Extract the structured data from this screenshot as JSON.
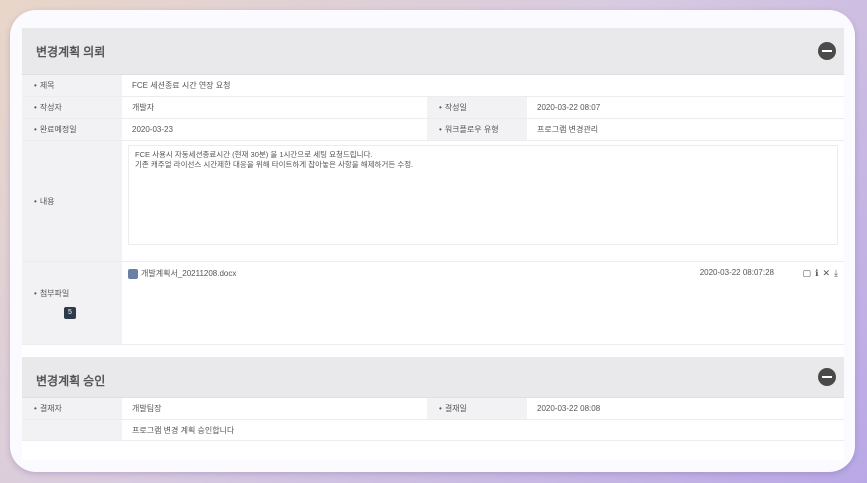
{
  "section1": {
    "title": "변경계획 의뢰",
    "rows": {
      "subject_label": "제목",
      "subject_value": "FCE 세션종료 시간 연장 요청",
      "author_label": "작성자",
      "author_value": "개발자",
      "written_label": "작성일",
      "written_value": "2020-03-22 08:07",
      "due_label": "완료예정일",
      "due_value": "2020-03-23",
      "workflow_label": "워크플로우 유형",
      "workflow_value": "프로그램 변경관리",
      "content_label": "내용",
      "content_line1": "FCE 사용시 자동세션종료시간 (현재 30분) 을 1시간으로 세팅 요청드립니다.",
      "content_line2": "기존 캐주얼 라이선스 시간제한 대응을 위해 타이트하게 잡아놓은 사항을 해제하거든 수정.",
      "attach_label": "첨부파일",
      "attach_count": "5",
      "attach_file": "개발계획서_20211208.docx",
      "attach_time": "2020-03-22 08:07:28"
    }
  },
  "section2": {
    "title": "변경계획 승인",
    "rows": {
      "approver_label": "결재자",
      "approver_value": "개발팀장",
      "approved_label": "결재일",
      "approved_value": "2020-03-22 08:08",
      "comment_value": "프로그램 변경 계획 승인합니다"
    }
  }
}
